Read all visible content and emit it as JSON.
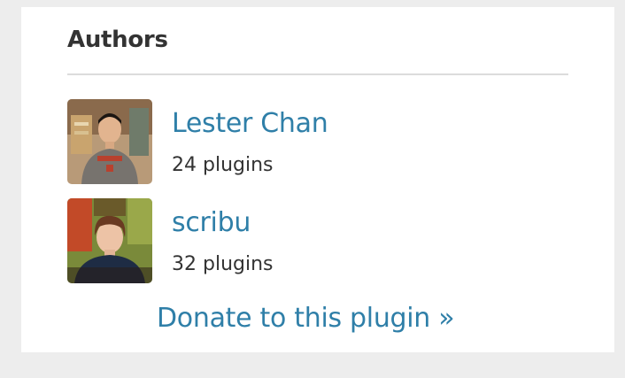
{
  "widget": {
    "title": "Authors",
    "authors": [
      {
        "name": "Lester Chan",
        "plugins": "24 plugins"
      },
      {
        "name": "scribu",
        "plugins": "32 plugins"
      }
    ],
    "donate_label": "Donate to this plugin »"
  },
  "colors": {
    "link": "#2f7fa8",
    "text": "#333333",
    "background": "#ededed",
    "card": "#ffffff",
    "divider": "#dcdcdc"
  }
}
